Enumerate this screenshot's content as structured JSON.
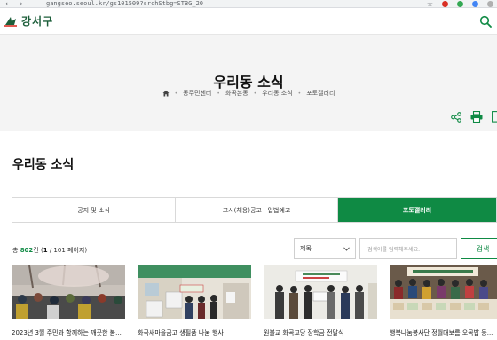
{
  "browser": {
    "url": "gangseo.seoul.kr/gs101509?srchStbg=STBG_20"
  },
  "header": {
    "logo_text": "강서구"
  },
  "visual": {
    "title": "우리동 소식",
    "breadcrumb": [
      "동주민센터",
      "화곡본동",
      "우리동 소식",
      "포토갤러리"
    ]
  },
  "section": {
    "title": "우리동 소식"
  },
  "tabs": [
    {
      "label": "공지 및 소식",
      "active": false
    },
    {
      "label": "고시(채용)공고 · 입법예고",
      "active": false
    },
    {
      "label": "포토갤러리",
      "active": true
    }
  ],
  "list": {
    "count_prefix": "총",
    "count_total": "802",
    "count_suffix": "건",
    "page_current": "1",
    "page_total": "101",
    "page_word": "페이지"
  },
  "search": {
    "select_value": "제목",
    "placeholder": "검색어를 입력해주세요.",
    "button_label": "검색"
  },
  "gallery": [
    {
      "caption": "2023년 3월 주민과 함께하는 깨끗한 봄..."
    },
    {
      "caption": "화곡새마을금고 생필품 나눔 행사"
    },
    {
      "caption": "원불교 화곡교당 장학금 전달식"
    },
    {
      "caption": "행복나눔봉사단 정월대보름 오곡밥 등..."
    }
  ],
  "colors": {
    "brand_green": "#0f8a44",
    "logo_green": "#1c5e3a",
    "visual_bg": "#f4f4f4"
  },
  "icons": [
    "search-icon",
    "home-icon",
    "share-icon",
    "print-icon",
    "chevron-down-icon"
  ]
}
